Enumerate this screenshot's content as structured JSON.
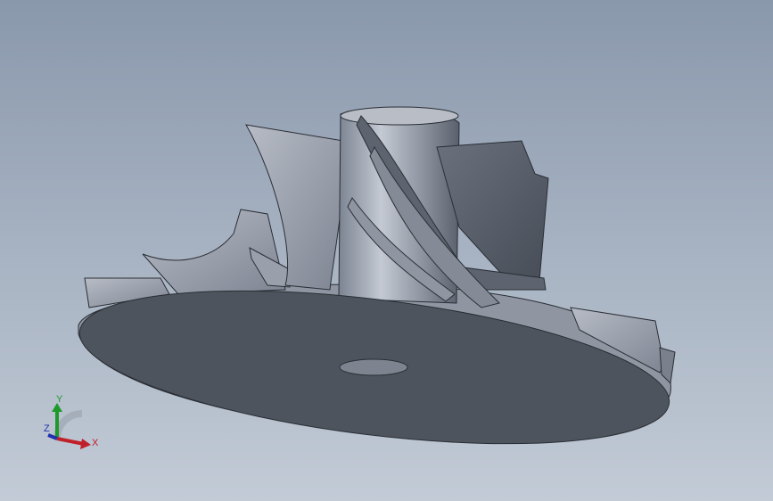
{
  "viewport": {
    "background_top": "#8a98ac",
    "background_bottom": "#c2cbd6",
    "model_description_icon": "impeller-3d-model"
  },
  "triad": {
    "x_label": "X",
    "y_label": "Y",
    "z_label": "Z",
    "x_color": "#c0202a",
    "y_color": "#1e9a2a",
    "z_color": "#2030b0"
  }
}
